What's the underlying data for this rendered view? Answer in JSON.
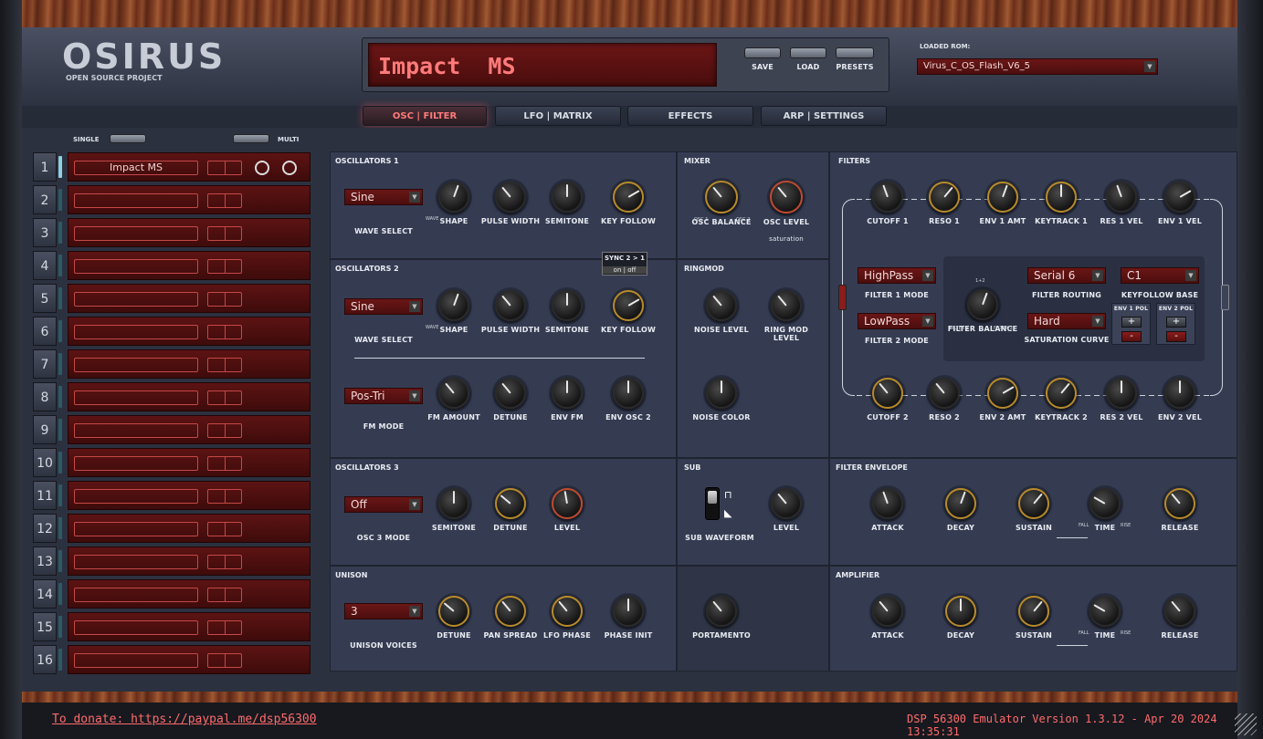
{
  "app": {
    "logo": "OSIRUS",
    "subtitle": "OPEN SOURCE PROJECT"
  },
  "display": {
    "patch_name": "Impact  MS"
  },
  "toolbar": {
    "save": "SAVE",
    "load": "LOAD",
    "presets": "PRESETS"
  },
  "rom": {
    "label": "LOADED ROM:",
    "value": "Virus_C_OS_Flash_V6_5"
  },
  "tabs": [
    "OSC | FILTER",
    "LFO | MATRIX",
    "EFFECTS",
    "ARP | SETTINGS"
  ],
  "mode": {
    "single": "SINGLE",
    "multi": "MULTI"
  },
  "parts": [
    {
      "num": "1",
      "name": "Impact  MS"
    },
    {
      "num": "2",
      "name": ""
    },
    {
      "num": "3",
      "name": ""
    },
    {
      "num": "4",
      "name": ""
    },
    {
      "num": "5",
      "name": ""
    },
    {
      "num": "6",
      "name": ""
    },
    {
      "num": "7",
      "name": ""
    },
    {
      "num": "8",
      "name": ""
    },
    {
      "num": "9",
      "name": ""
    },
    {
      "num": "10",
      "name": ""
    },
    {
      "num": "11",
      "name": ""
    },
    {
      "num": "12",
      "name": ""
    },
    {
      "num": "13",
      "name": ""
    },
    {
      "num": "14",
      "name": ""
    },
    {
      "num": "15",
      "name": ""
    },
    {
      "num": "16",
      "name": ""
    }
  ],
  "osc1": {
    "title": "OSCILLATORS 1",
    "wave": "Sine",
    "wave_label": "WAVE SELECT",
    "shape": "SHAPE",
    "pw": "PULSE WIDTH",
    "semi": "SEMITONE",
    "kf": "KEY FOLLOW",
    "wave_tick": "WAVE",
    "sync_label": "SYNC 2 > 1",
    "sync_state": "on | off"
  },
  "osc2": {
    "title": "OSCILLATORS 2",
    "wave": "Sine",
    "wave_label": "WAVE SELECT",
    "shape": "SHAPE",
    "pw": "PULSE WIDTH",
    "semi": "SEMITONE",
    "kf": "KEY FOLLOW",
    "fm_mode": "Pos-Tri",
    "fm_mode_label": "FM MODE",
    "fm_amount": "FM AMOUNT",
    "detune": "DETUNE",
    "env_fm": "ENV FM",
    "env_osc2": "ENV OSC 2",
    "wave_tick": "WAVE"
  },
  "osc3": {
    "title": "OSCILLATORS 3",
    "mode": "Off",
    "mode_label": "OSC 3 MODE",
    "semi": "SEMITONE",
    "detune": "DETUNE",
    "level": "LEVEL"
  },
  "unison": {
    "title": "UNISON",
    "voices": "3",
    "voices_label": "UNISON VOICES",
    "detune": "DETUNE",
    "pan": "PAN SPREAD",
    "lfo_phase": "LFO PHASE",
    "phase_init": "PHASE INIT"
  },
  "mixer": {
    "title": "MIXER",
    "balance": "OSC BALANCE",
    "level": "OSC LEVEL",
    "level_sub": "saturation",
    "osc1": "OSC 1",
    "osc2": "OSC 2"
  },
  "ringmod": {
    "title": "RINGMOD",
    "noise": "NOISE LEVEL",
    "ring": "RING MOD LEVEL",
    "noise_color": "NOISE COLOR"
  },
  "sub": {
    "title": "SUB",
    "waveform": "SUB WAVEFORM",
    "level": "LEVEL"
  },
  "porta": {
    "label": "PORTAMENTO"
  },
  "filters": {
    "title": "FILTERS",
    "row1": [
      "CUTOFF 1",
      "RESO 1",
      "ENV 1 AMT",
      "KEYTRACK 1",
      "RES 1 VEL",
      "ENV 1 VEL"
    ],
    "row2": [
      "CUTOFF 2",
      "RESO 2",
      "ENV 2 AMT",
      "KEYTRACK 2",
      "RES 2 VEL",
      "ENV 2 VEL"
    ],
    "f1_mode": "HighPass",
    "f1_mode_label": "FILTER 1 MODE",
    "f2_mode": "LowPass",
    "f2_mode_label": "FILTER 2 MODE",
    "balance": "FILTER BALANCE",
    "routing": "Serial 6",
    "routing_label": "FILTER ROUTING",
    "sat": "Hard",
    "sat_label": "SATURATION CURVE",
    "kfbase": "C1",
    "kfbase_label": "KEYFOLLOW BASE",
    "env1pol": "ENV 1 POL",
    "env2pol": "ENV 2 POL",
    "t12": "1+2",
    "tf1": "FILTER 1",
    "tf2": "FILTER 2"
  },
  "fenv": {
    "title": "FILTER ENVELOPE",
    "attack": "ATTACK",
    "decay": "DECAY",
    "sustain": "SUSTAIN",
    "time": "TIME",
    "release": "RELEASE",
    "fall": "FALL",
    "rise": "RISE"
  },
  "amp": {
    "title": "AMPLIFIER",
    "attack": "ATTACK",
    "decay": "DECAY",
    "sustain": "SUSTAIN",
    "time": "TIME",
    "release": "RELEASE",
    "fall": "FALL",
    "rise": "RISE"
  },
  "footer": {
    "donate": "To donate: https://paypal.me/dsp56300",
    "version": "DSP 56300 Emulator Version 1.3.12 - Apr 20 2024 13:35:31"
  },
  "colors": {
    "accent": "#ff6b6b",
    "lcd": "#5a1010",
    "panel": "#353c52",
    "gold_ring": "#b88a2a"
  }
}
